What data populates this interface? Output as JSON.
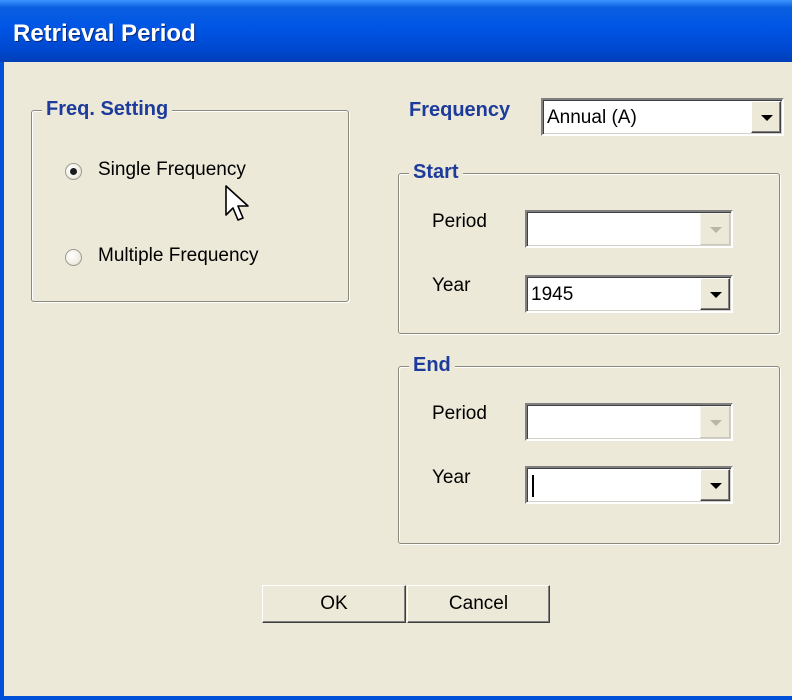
{
  "window": {
    "title": "Retrieval Period"
  },
  "freq_setting": {
    "legend": "Freq. Setting",
    "options": [
      {
        "label": "Single Frequency",
        "selected": true
      },
      {
        "label": "Multiple Frequency",
        "selected": false
      }
    ]
  },
  "frequency": {
    "label": "Frequency",
    "value": "Annual (A)"
  },
  "start": {
    "legend": "Start",
    "period_label": "Period",
    "period_value": "",
    "year_label": "Year",
    "year_value": "1945"
  },
  "end": {
    "legend": "End",
    "period_label": "Period",
    "period_value": "",
    "year_label": "Year",
    "year_value": ""
  },
  "buttons": {
    "ok": "OK",
    "cancel": "Cancel"
  },
  "colors": {
    "title_bar": "#0055e5",
    "dialog_bg": "#ece9d8",
    "legend_text": "#1d3b9b"
  },
  "icons": {
    "pointer": "arrow-cursor-icon"
  }
}
